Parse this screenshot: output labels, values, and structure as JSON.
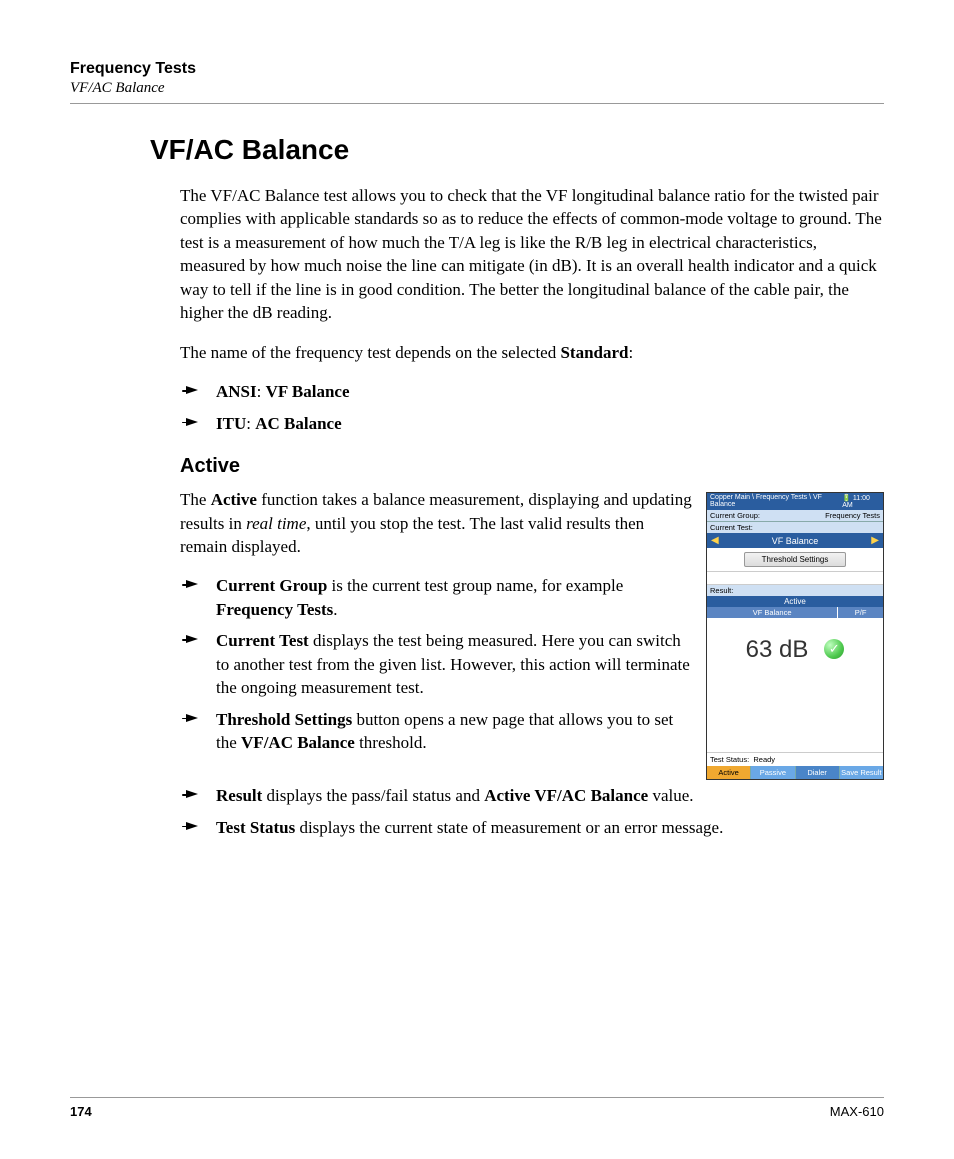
{
  "header": {
    "title": "Frequency Tests",
    "subtitle": "VF/AC Balance"
  },
  "h1": "VF/AC Balance",
  "intro": "The VF/AC Balance test allows you to check that the VF longitudinal balance ratio for the twisted pair complies with applicable standards so as to reduce the effects of common-mode voltage to ground. The test is a measurement of how much the T/A leg is like the R/B leg in electrical characteristics, measured by how much noise the line can mitigate (in dB). It is an overall health indicator and a quick way to tell if the line is in good condition. The better the longitudinal balance of the cable pair, the higher the dB reading.",
  "name_line_pre": "The name of the frequency test depends on the selected ",
  "name_line_bold": "Standard",
  "name_line_post": ":",
  "std_bullets": {
    "ansi_b": "ANSI",
    "ansi_t": ": ",
    "ansi_b2": "VF Balance",
    "itu_b": "ITU",
    "itu_t": ": ",
    "itu_b2": "AC Balance"
  },
  "h2": "Active",
  "active_para": {
    "p1": "The ",
    "b1": "Active",
    "p2": " function takes a balance measurement, displaying and updating results in ",
    "i1": "real time",
    "p3": ", until you stop the test. The last valid results then remain displayed."
  },
  "items": {
    "cg_b": "Current Group",
    "cg_t": " is the current test group name, for example ",
    "cg_b2": "Frequency Tests",
    "cg_post": ".",
    "ct_b": "Current Test",
    "ct_t": " displays the test being measured. Here you can switch to another test from the given list. However, this action will terminate the ongoing measurement test.",
    "ts_b": "Threshold Settings",
    "ts_t": " button opens a new page that allows you to set the ",
    "ts_b2": "VF/AC Balance",
    "ts_post": " threshold.",
    "res_b": "Result",
    "res_t": " displays the pass/fail status and ",
    "res_b2": "Active VF/AC Balance",
    "res_post": " value.",
    "stat_b": "Test Status",
    "stat_t": " displays the current state of measurement or an error message."
  },
  "screenshot": {
    "breadcrumb": "Copper Main \\ Frequency Tests \\ VF Balance",
    "time": "11:00 AM",
    "cg_label": "Current Group:",
    "cg_value": "Frequency Tests",
    "ct_label": "Current Test:",
    "nav_title": "VF Balance",
    "threshold_btn": "Threshold Settings",
    "result_label": "Result:",
    "active_bar": "Active",
    "col_left": "VF Balance",
    "col_right": "P/F",
    "value": "63 dB",
    "status_label": "Test Status:",
    "status_value": "Ready",
    "tabs": [
      "Active",
      "Passive",
      "Dialer",
      "Save Result"
    ]
  },
  "footer": {
    "page": "174",
    "doc": "MAX-610"
  }
}
